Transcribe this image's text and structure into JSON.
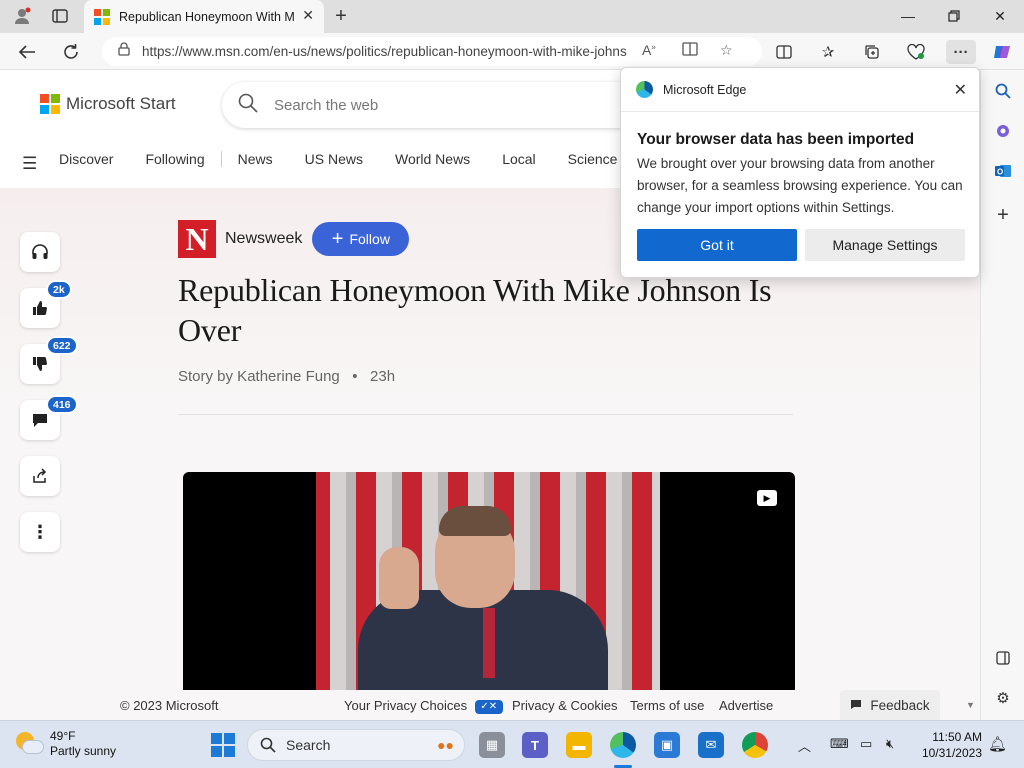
{
  "browser": {
    "tab_title": "Republican Honeymoon With Mike Johnson Is Over",
    "url": "https://www.msn.com/en-us/news/politics/republican-honeymoon-with-mike-johnson-is-over"
  },
  "header": {
    "brand": "Microsoft Start",
    "search_placeholder": "Search the web",
    "nav": [
      "Discover",
      "Following",
      "News",
      "US News",
      "World News",
      "Local",
      "Science"
    ]
  },
  "article": {
    "source": "Newsweek",
    "source_logo_letter": "N",
    "follow_label": "Follow",
    "headline": "Republican Honeymoon With Mike Johnson Is Over",
    "byline": "Story by Katherine Fung",
    "age": "23h",
    "likes": "2k",
    "dislikes": "622",
    "comments": "416"
  },
  "footer": {
    "copyright": "© 2023 Microsoft",
    "privacy_choices": "Your Privacy Choices",
    "privacy_cookies": "Privacy & Cookies",
    "terms": "Terms of use",
    "advertise": "Advertise",
    "feedback": "Feedback"
  },
  "popup": {
    "app_name": "Microsoft Edge",
    "title": "Your browser data has been imported",
    "body": "We brought over your browsing data from another browser, for a seamless browsing experience. You can change your import options within Settings.",
    "primary_button": "Got it",
    "secondary_button": "Manage Settings"
  },
  "taskbar": {
    "temperature": "49°F",
    "condition": "Partly sunny",
    "search_label": "Search",
    "time": "11:50 AM",
    "date": "10/31/2023"
  },
  "colors": {
    "accent": "#1169d0",
    "follow": "#3b63d8",
    "newsweek_red": "#d21e26",
    "badge": "#1b64c9"
  }
}
